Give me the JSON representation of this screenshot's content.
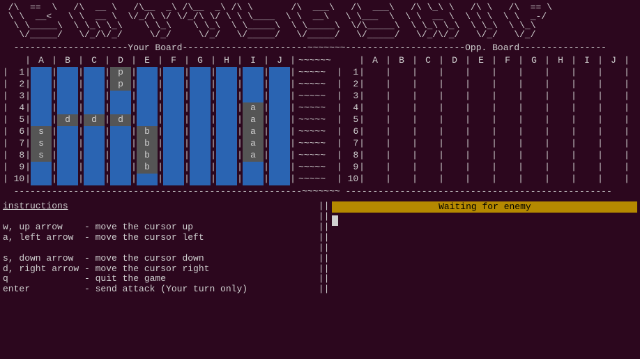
{
  "banner_lines": [
    " /\\  ==  \\   /\\  __ \\   /\\__  _\\ /\\__  _\\ /\\ \\       /\\  ___\\   /\\  ___\\   /\\ \\_\\ \\   /\\ \\   /\\  == \\",
    " \\ \\  __<   \\ \\  __ \\  \\/_/\\ \\/ \\/_/\\ \\/ \\ \\ \\____  \\ \\  __\\   \\ \\___  \\  \\ \\  __ \\  \\ \\ \\  \\ \\  _-/",
    "  \\ \\_____\\  \\ \\_\\ \\_\\    \\ \\_\\    \\ \\_\\  \\ \\_____\\  \\ \\_____\\  \\/\\_____\\  \\ \\_\\ \\_\\  \\ \\_\\  \\ \\_\\",
    "   \\/_____/   \\/_/\\/_/     \\/_/     \\/_/   \\/_____/   \\/_____/   \\/_____/   \\/_/\\/_/   \\/_/   \\/_/"
  ],
  "titles": {
    "your": "Your Board",
    "opp": "Opp. Board"
  },
  "divider_full": "  ---------------------Your Board-----------------------~~~~~~~----------------------Opp. Board----------------",
  "columns": [
    "A",
    "B",
    "C",
    "D",
    "E",
    "F",
    "G",
    "H",
    "I",
    "J"
  ],
  "rows": [
    "1",
    "2",
    "3",
    "4",
    "5",
    "6",
    "7",
    "8",
    "9",
    "10"
  ],
  "waves_header": "~~~~~~",
  "waves_row": "~~~~~",
  "your_board": [
    [
      "w",
      "w",
      "w",
      "p",
      "w",
      "w",
      "w",
      "w",
      "w",
      "w"
    ],
    [
      "w",
      "w",
      "w",
      "p",
      "w",
      "w",
      "w",
      "w",
      "w",
      "w"
    ],
    [
      "w",
      "w",
      "w",
      "w",
      "w",
      "w",
      "w",
      "w",
      "w",
      "w"
    ],
    [
      "w",
      "w",
      "w",
      "w",
      "w",
      "w",
      "w",
      "w",
      "a",
      "w"
    ],
    [
      "w",
      "d",
      "d",
      "d",
      "w",
      "w",
      "w",
      "w",
      "a",
      "w"
    ],
    [
      "s",
      "w",
      "w",
      "w",
      "b",
      "w",
      "w",
      "w",
      "a",
      "w"
    ],
    [
      "s",
      "w",
      "w",
      "w",
      "b",
      "w",
      "w",
      "w",
      "a",
      "w"
    ],
    [
      "s",
      "w",
      "w",
      "w",
      "b",
      "w",
      "w",
      "w",
      "a",
      "w"
    ],
    [
      "w",
      "w",
      "w",
      "w",
      "b",
      "w",
      "w",
      "w",
      "w",
      "w"
    ],
    [
      "w",
      "w",
      "w",
      "w",
      "w",
      "w",
      "w",
      "w",
      "w",
      "w"
    ]
  ],
  "opp_board": [
    [
      "",
      "",
      "",
      "",
      "",
      "",
      "",
      "",
      "",
      ""
    ],
    [
      "",
      "",
      "",
      "",
      "",
      "",
      "",
      "",
      "",
      ""
    ],
    [
      "",
      "",
      "",
      "",
      "",
      "",
      "",
      "",
      "",
      ""
    ],
    [
      "",
      "",
      "",
      "",
      "",
      "",
      "",
      "",
      "",
      ""
    ],
    [
      "",
      "",
      "",
      "",
      "",
      "",
      "",
      "",
      "",
      ""
    ],
    [
      "",
      "",
      "",
      "",
      "",
      "",
      "",
      "",
      "",
      ""
    ],
    [
      "",
      "",
      "",
      "",
      "",
      "",
      "",
      "",
      "",
      ""
    ],
    [
      "",
      "",
      "",
      "",
      "",
      "",
      "",
      "",
      "",
      ""
    ],
    [
      "",
      "",
      "",
      "",
      "",
      "",
      "",
      "",
      "",
      ""
    ],
    [
      "",
      "",
      "",
      "",
      "",
      "",
      "",
      "",
      "",
      ""
    ]
  ],
  "bottom_dashes": "  -----------------------------------------------------~~~~~~~ -------------------------------------------------",
  "instructions_title": "instructions",
  "instructions_lines": [
    "",
    "w, up arrow    - move the cursor up",
    "a, left arrow  - move the cursor left",
    "",
    "s, down arrow  - move the cursor down",
    "d, right arrow - move the cursor right",
    "q              - quit the game",
    "enter          - send attack (Your turn only)"
  ],
  "status": "Waiting for enemy",
  "ship_letters": {
    "p": "p",
    "d": "d",
    "s": "s",
    "b": "b",
    "a": "a"
  }
}
